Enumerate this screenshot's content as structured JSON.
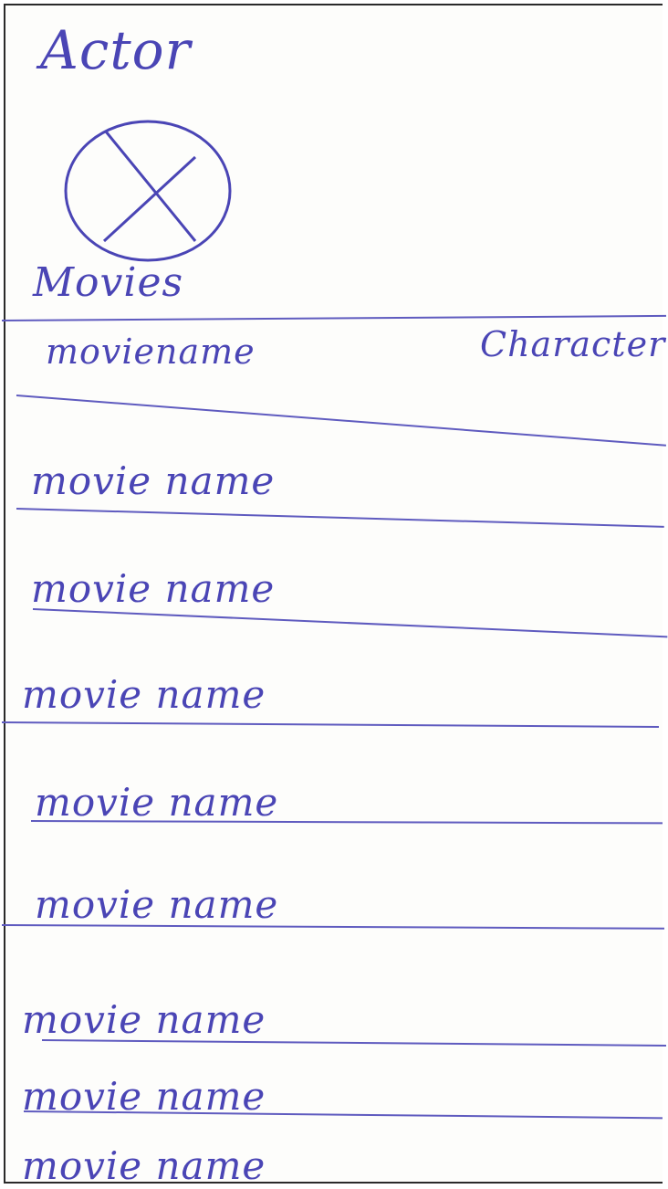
{
  "header": {
    "title": "Actor",
    "avatar_icon": "image-placeholder-icon"
  },
  "movies": {
    "heading": "Movies",
    "columns": {
      "movie": "moviename",
      "character": "Character"
    },
    "rows": [
      {
        "label": "movie name"
      },
      {
        "label": "movie name"
      },
      {
        "label": "movie name"
      },
      {
        "label": "movie name"
      },
      {
        "label": "movie name"
      },
      {
        "label": "movie name"
      },
      {
        "label": "movie name"
      },
      {
        "label": "movie name"
      }
    ]
  },
  "colors": {
    "ink": "#4a45b5",
    "border": "#2a2a2a"
  }
}
